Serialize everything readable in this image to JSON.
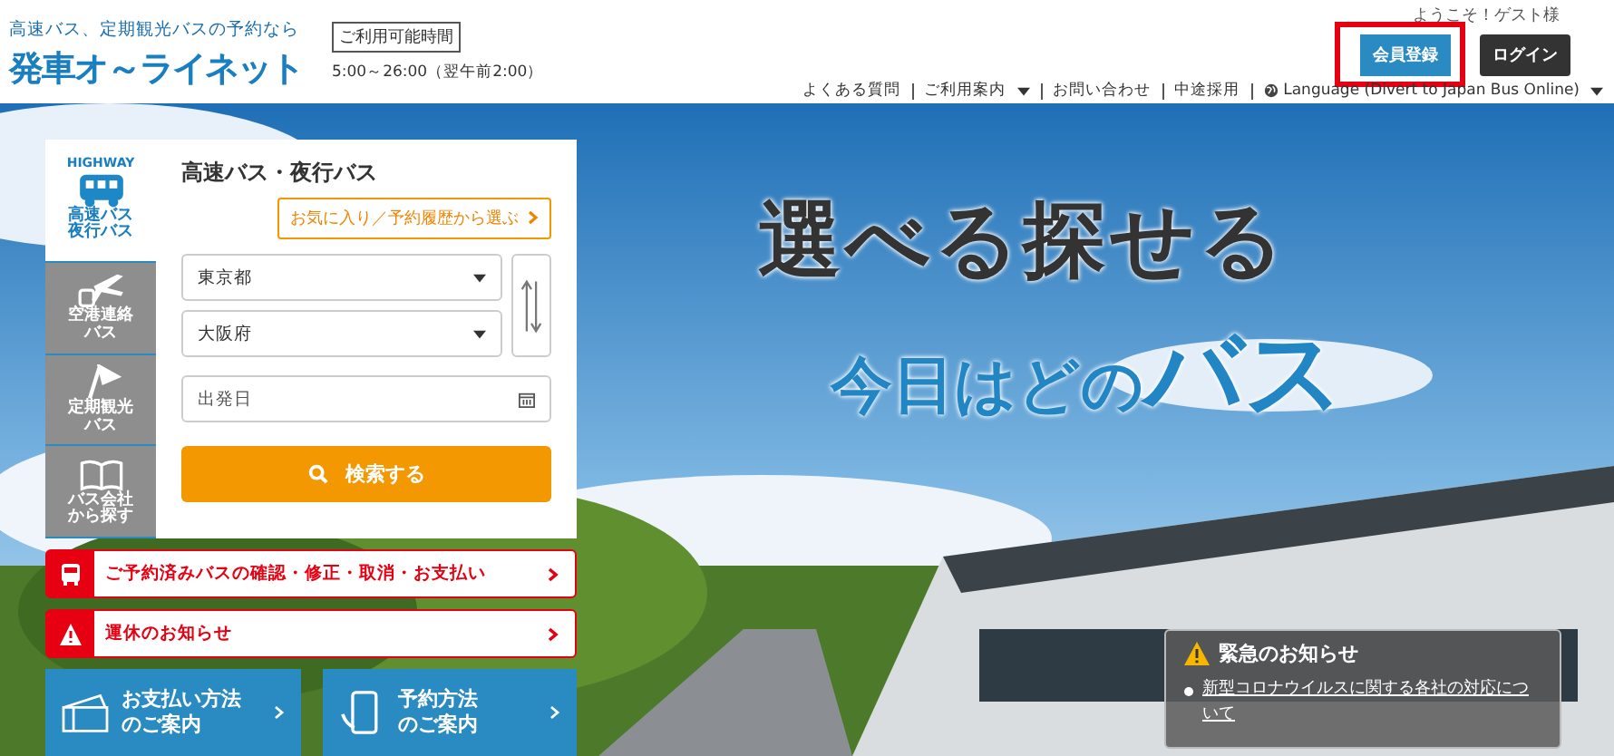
{
  "header": {
    "tagline": "高速バス、定期観光バスの予約なら",
    "logo": "発車オ～ライネット",
    "hours_label": "ご利用可能時間",
    "hours": "5:00～26:00（翌午前2:00）",
    "welcome": "ようこそ！ゲスト様",
    "buttons": [
      {
        "label": "会員登録",
        "kind": "register",
        "highlighted": true
      },
      {
        "label": "ログイン",
        "kind": "login",
        "highlighted": false
      }
    ],
    "nav": [
      {
        "label": "よくある質問",
        "dropdown": false,
        "globe": false
      },
      {
        "label": "ご利用案内",
        "dropdown": true,
        "globe": false
      },
      {
        "label": "お問い合わせ",
        "dropdown": false,
        "globe": false
      },
      {
        "label": "中途採用",
        "dropdown": false,
        "globe": false
      },
      {
        "label": "Language (Divert to Japan Bus Online)",
        "dropdown": true,
        "globe": true
      }
    ]
  },
  "hero": {
    "line1": "選べる探せる",
    "line2": [
      {
        "text": "今日はどの",
        "emphasis": false
      },
      {
        "text": "バス",
        "emphasis": true
      }
    ]
  },
  "search_tabs": [
    {
      "kind": "highway",
      "caption": "HIGHWAY",
      "label": "高速バス夜行バス",
      "selected": true
    },
    {
      "kind": "airport",
      "label": "空港連絡バス",
      "selected": false
    },
    {
      "kind": "sightseeing",
      "label": "定期観光バス",
      "selected": false
    },
    {
      "kind": "company",
      "label": "バス会社から探す",
      "selected": false
    }
  ],
  "search": {
    "title": "高速バス・夜行バス",
    "history_button": "お気に入り／予約履歴から選ぶ",
    "from": "東京都",
    "to": "大阪府",
    "date_placeholder": "出発日",
    "submit": "検索する"
  },
  "alerts": [
    {
      "kind": "bus",
      "label": "ご予約済みバスの確認・修正・取消・お支払い"
    },
    {
      "kind": "warning",
      "label": "運休のお知らせ"
    }
  ],
  "guides": [
    {
      "kind": "payment",
      "label": "お支払い方法のご案内"
    },
    {
      "kind": "phone",
      "label": "予約方法のご案内"
    }
  ],
  "notice": {
    "title": "緊急のお知らせ",
    "link": "新型コロナウイルスに関する各社の対応について"
  }
}
